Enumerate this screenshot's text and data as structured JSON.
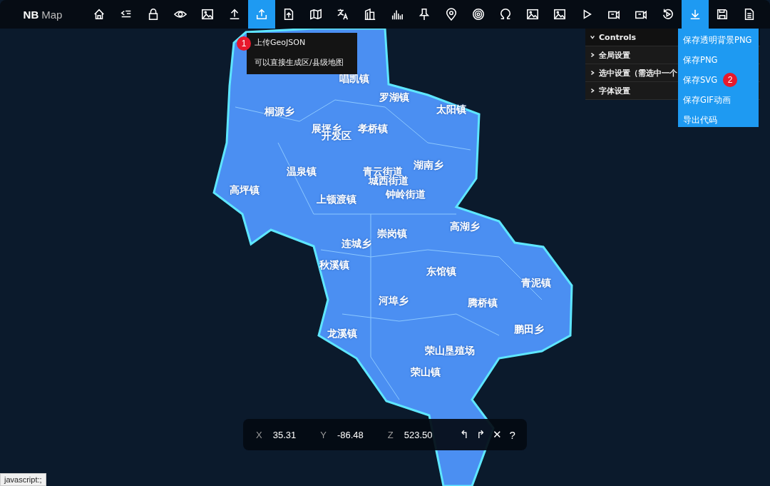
{
  "app": {
    "logo_bold": "NB",
    "logo_light": "Map"
  },
  "toolbar": [
    {
      "selected": false
    },
    {
      "selected": false
    },
    {
      "selected": false
    },
    {
      "selected": false
    },
    {
      "selected": false
    },
    {
      "selected": false
    },
    {
      "selected": true
    },
    {
      "selected": false
    },
    {
      "selected": false
    },
    {
      "selected": false
    },
    {
      "selected": false
    },
    {
      "selected": false
    },
    {
      "selected": false
    },
    {
      "selected": false
    },
    {
      "selected": false
    },
    {
      "selected": false
    },
    {
      "selected": false
    },
    {
      "selected": false
    },
    {
      "selected": false
    },
    {
      "selected": false
    },
    {
      "selected": false
    },
    {
      "selected": false
    },
    {
      "selected": true
    },
    {
      "selected": false
    },
    {
      "selected": false
    }
  ],
  "tooltip": {
    "badge": "1",
    "title": "上传GeoJSON",
    "description": "可以直接生成区/县级地图"
  },
  "controls": {
    "title": "Controls",
    "expanded": true,
    "folders": [
      {
        "label": "全局设置",
        "expanded": false
      },
      {
        "label": "选中设置（需选中一个",
        "expanded": false
      },
      {
        "label": "字体设置",
        "expanded": false
      }
    ]
  },
  "download_menu": [
    {
      "label": "保存透明背景PNG"
    },
    {
      "label": "保存PNG"
    },
    {
      "label": "保存SVG",
      "badge": "2"
    },
    {
      "label": "保存GIF动画"
    },
    {
      "label": "导出代码"
    }
  ],
  "map_labels": [
    "唱凯镇",
    "罗湖镇",
    "太阳镇",
    "桐源乡",
    "展坪乡",
    "开发区",
    "孝桥镇",
    "湖南乡",
    "温泉镇",
    "青云街道",
    "城西街道",
    "高坪镇",
    "上顿渡镇",
    "钟岭街道",
    "崇岗镇",
    "高湖乡",
    "连城乡",
    "秋溪镇",
    "东馆镇",
    "青泥镇",
    "河埠乡",
    "腾桥镇",
    "鹏田乡",
    "龙溪镇",
    "荣山垦殖场",
    "荣山镇"
  ],
  "coords": [
    {
      "axis": "X",
      "value": "35.31"
    },
    {
      "axis": "Y",
      "value": "-86.48"
    },
    {
      "axis": "Z",
      "value": "523.50"
    }
  ],
  "coord_actions": [
    {
      "symbol": "↰"
    },
    {
      "symbol": "↱"
    },
    {
      "symbol": "✕"
    },
    {
      "symbol": "?"
    }
  ],
  "status_bar": "javascript:;"
}
